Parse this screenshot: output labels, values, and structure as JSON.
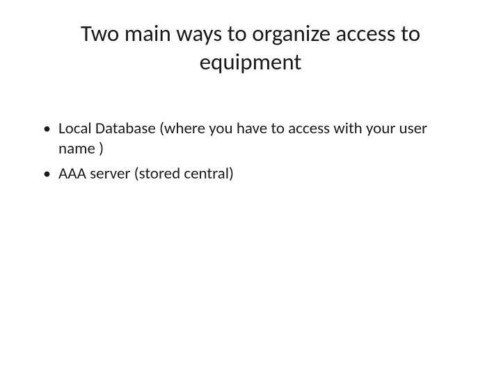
{
  "slide": {
    "title": "Two main ways to organize access to equipment",
    "bullets": [
      "Local Database (where you have to access with your user name )",
      "AAA server (stored central)"
    ]
  }
}
